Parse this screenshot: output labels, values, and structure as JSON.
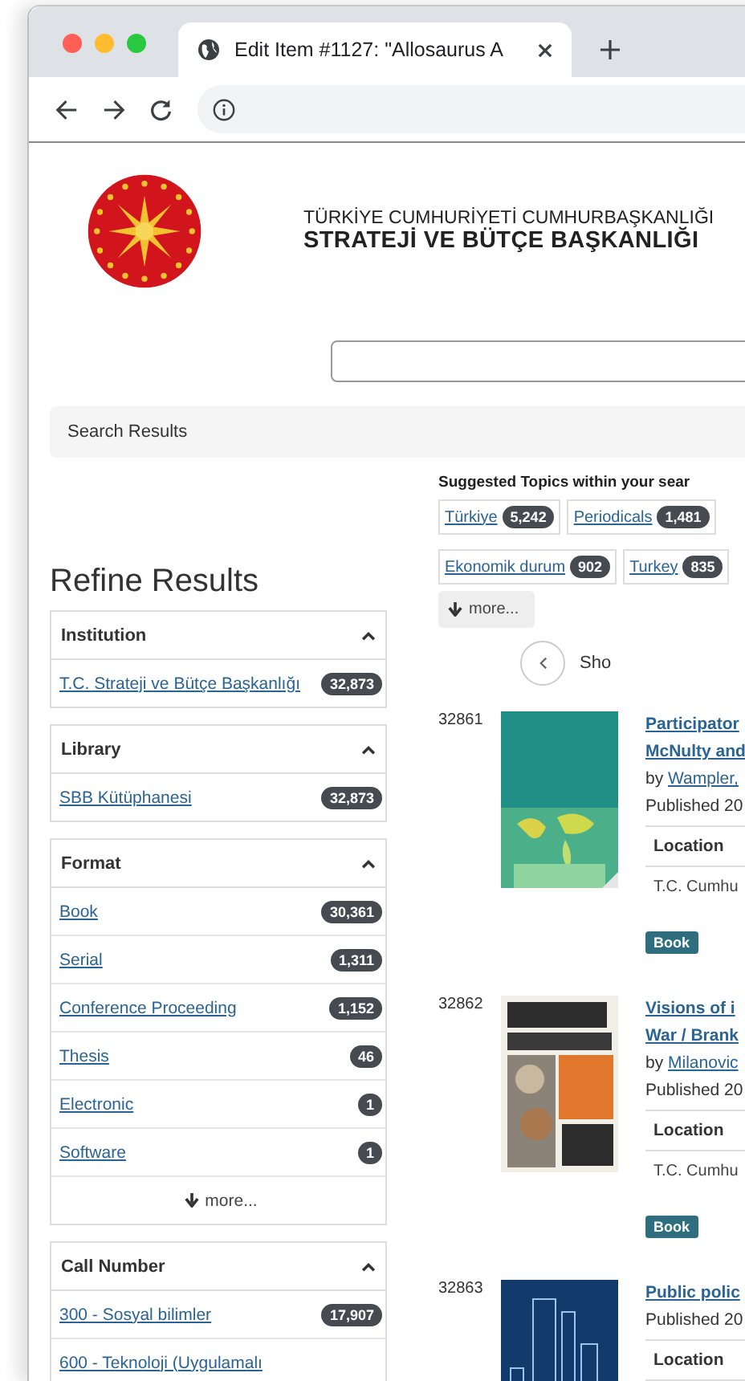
{
  "browser": {
    "tab_title": "Edit Item #1127: \"Allosaurus A"
  },
  "header": {
    "line1": "TÜRKİYE CUMHURİYETİ CUMHURBAŞKANLIĞI",
    "line2": "STRATEJİ VE BÜTÇE BAŞKANLIĞI"
  },
  "breadcrumb": "Search Results",
  "sidebar": {
    "title": "Refine Results",
    "facets": [
      {
        "title": "Institution",
        "expanded": true,
        "items": [
          {
            "label": "T.C. Strateji ve Bütçe Başkanlığı",
            "count": "32,873"
          }
        ]
      },
      {
        "title": "Library",
        "expanded": true,
        "items": [
          {
            "label": "SBB Kütüphanesi",
            "count": "32,873"
          }
        ]
      },
      {
        "title": "Format",
        "expanded": true,
        "more": "more...",
        "items": [
          {
            "label": "Book",
            "count": "30,361"
          },
          {
            "label": "Serial",
            "count": "1,311"
          },
          {
            "label": "Conference Proceeding",
            "count": "1,152"
          },
          {
            "label": "Thesis",
            "count": "46"
          },
          {
            "label": "Electronic",
            "count": "1"
          },
          {
            "label": "Software",
            "count": "1"
          }
        ]
      },
      {
        "title": "Call Number",
        "expanded": true,
        "items": [
          {
            "label": "300 - Sosyal bilimler",
            "count": "17,907"
          },
          {
            "label": "600 - Teknoloji (Uygulamalı"
          }
        ]
      }
    ]
  },
  "suggested": {
    "title": "Suggested Topics within your sear",
    "rows": [
      [
        {
          "label": "Türkiye",
          "count": "5,242"
        },
        {
          "label": "Periodicals",
          "count": "1,481"
        }
      ],
      [
        {
          "label": "Ekonomik durum",
          "count": "902"
        },
        {
          "label": "Turkey",
          "count": "835"
        }
      ]
    ],
    "more": "more..."
  },
  "pagination": {
    "text": "Sho"
  },
  "results": [
    {
      "number": "32861",
      "title": [
        "Participator",
        "McNulty and"
      ],
      "author": "Wampler,",
      "by": "by",
      "published": "Published 20",
      "location_header": "Location",
      "location": "T.C. Cumhu",
      "format": "Book"
    },
    {
      "number": "32862",
      "title": [
        "Visions of i",
        "War / Brank"
      ],
      "author": "Milanovic",
      "by": "by",
      "published": "Published 20",
      "location_header": "Location",
      "location": "T.C. Cumhu",
      "format": "Book"
    },
    {
      "number": "32863",
      "title": [
        "Public polic"
      ],
      "published": "Published 20",
      "location_header": "Location"
    }
  ]
}
